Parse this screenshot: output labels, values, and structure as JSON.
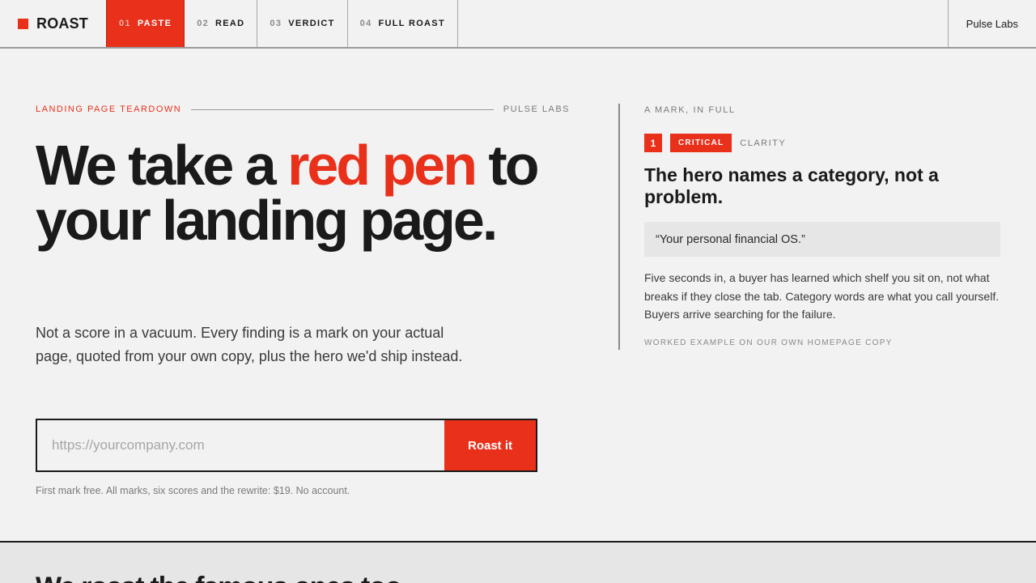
{
  "header": {
    "brand": "ROAST",
    "steps": [
      {
        "num": "01",
        "label": "PASTE"
      },
      {
        "num": "02",
        "label": "READ"
      },
      {
        "num": "03",
        "label": "VERDICT"
      },
      {
        "num": "04",
        "label": "FULL ROAST"
      }
    ],
    "active_step": 0,
    "org": "Pulse Labs"
  },
  "hero": {
    "eyebrow": "LANDING PAGE TEARDOWN",
    "eyebrow_right": "PULSE LABS",
    "headline_before": "We take a ",
    "headline_accent": "red pen",
    "headline_after": " to your landing page.",
    "lede": "Not a score in a vacuum. Every finding is a mark on your actual page, quoted from your own copy, plus the hero we'd ship instead.",
    "url_placeholder": "https://yourcompany.com",
    "url_value": "",
    "submit_label": "Roast it",
    "fineprint": "First mark free. All marks, six scores and the rewrite: $19. No account."
  },
  "mark": {
    "eyebrow": "A MARK, IN FULL",
    "number": "1",
    "severity": "CRITICAL",
    "category": "CLARITY",
    "title": "The hero names a category, not a problem.",
    "quote": "“Your personal financial OS.”",
    "body": "Five seconds in, a buyer has learned which shelf you sit on, not what breaks if they close the tab. Category words are what you call yourself. Buyers arrive searching for the failure.",
    "footnote": "WORKED EXAMPLE ON OUR OWN HOMEPAGE COPY"
  },
  "lower": {
    "title": "We roast the famous ones too"
  },
  "colors": {
    "accent": "#e8301a",
    "ink": "#1a1a1a",
    "background": "#f2f2f2"
  }
}
